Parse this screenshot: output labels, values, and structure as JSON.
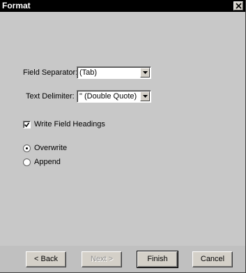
{
  "window": {
    "title": "Format"
  },
  "form": {
    "field_separator_label": "Field Separator:",
    "field_separator_value": "(Tab)",
    "text_delimiter_label": "Text Delimiter:",
    "text_delimiter_value": "\" (Double Quote)",
    "write_headings_label": "Write Field Headings",
    "write_headings_checked": true,
    "mode_options": [
      {
        "label": "Overwrite",
        "selected": true
      },
      {
        "label": "Append",
        "selected": false
      }
    ]
  },
  "buttons": {
    "back_label": "< Back",
    "next_label": "Next >",
    "finish_label": "Finish",
    "cancel_label": "Cancel"
  }
}
